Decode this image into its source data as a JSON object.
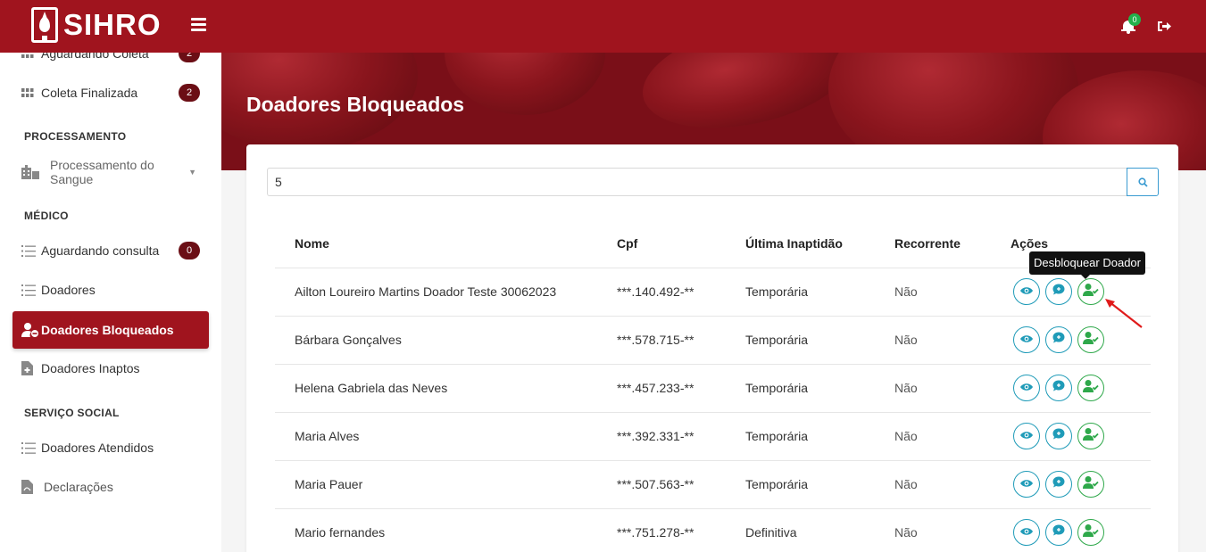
{
  "app": {
    "name": "SIHRO",
    "notification_count": "0",
    "colors": {
      "brand": "#a0141e",
      "brand_dark": "#6b0e15",
      "action_blue": "#1f9bb8",
      "action_green": "#2ea84a"
    }
  },
  "sidebar": {
    "items_top": [
      {
        "label": "Aguardando Coleta",
        "badge": "2",
        "icon": "grid-icon"
      },
      {
        "label": "Coleta Finalizada",
        "badge": "2",
        "icon": "grid-icon"
      }
    ],
    "section_processamento": "PROCESSAMENTO",
    "processamento_item": {
      "label": "Processamento do Sangue",
      "icon": "hospital-icon"
    },
    "section_medico": "MÉDICO",
    "medico_items": [
      {
        "label": "Aguardando consulta",
        "badge": "0",
        "icon": "list-icon"
      },
      {
        "label": "Doadores",
        "icon": "list-icon"
      },
      {
        "label": "Doadores Bloqueados",
        "icon": "user-block-icon",
        "active": true
      },
      {
        "label": "Doadores Inaptos",
        "icon": "file-medical-icon"
      }
    ],
    "section_servico": "SERVIÇO SOCIAL",
    "servico_items": [
      {
        "label": "Doadores Atendidos",
        "icon": "list-icon"
      },
      {
        "label": "Declarações",
        "icon": "file-icon"
      }
    ]
  },
  "page": {
    "title": "Doadores Bloqueados",
    "search_value": "5"
  },
  "table": {
    "headers": [
      "Nome",
      "Cpf",
      "Última Inaptidão",
      "Recorrente",
      "Ações"
    ],
    "rows": [
      {
        "nome": "Ailton Loureiro Martins Doador Teste 30062023",
        "cpf": "***.140.492-**",
        "inaptidao": "Temporária",
        "recorrente": "Não"
      },
      {
        "nome": "Bárbara Gonçalves",
        "cpf": "***.578.715-**",
        "inaptidao": "Temporária",
        "recorrente": "Não"
      },
      {
        "nome": "Helena Gabriela das Neves",
        "cpf": "***.457.233-**",
        "inaptidao": "Temporária",
        "recorrente": "Não"
      },
      {
        "nome": "Maria Alves",
        "cpf": "***.392.331-**",
        "inaptidao": "Temporária",
        "recorrente": "Não"
      },
      {
        "nome": "Maria Pauer",
        "cpf": "***.507.563-**",
        "inaptidao": "Temporária",
        "recorrente": "Não"
      },
      {
        "nome": "Mario fernandes",
        "cpf": "***.751.278-**",
        "inaptidao": "Definitiva",
        "recorrente": "Não"
      }
    ],
    "action_icons": [
      "eye-icon",
      "chat-icon",
      "user-check-icon"
    ]
  },
  "tooltip": {
    "text": "Desbloquear Doador"
  }
}
